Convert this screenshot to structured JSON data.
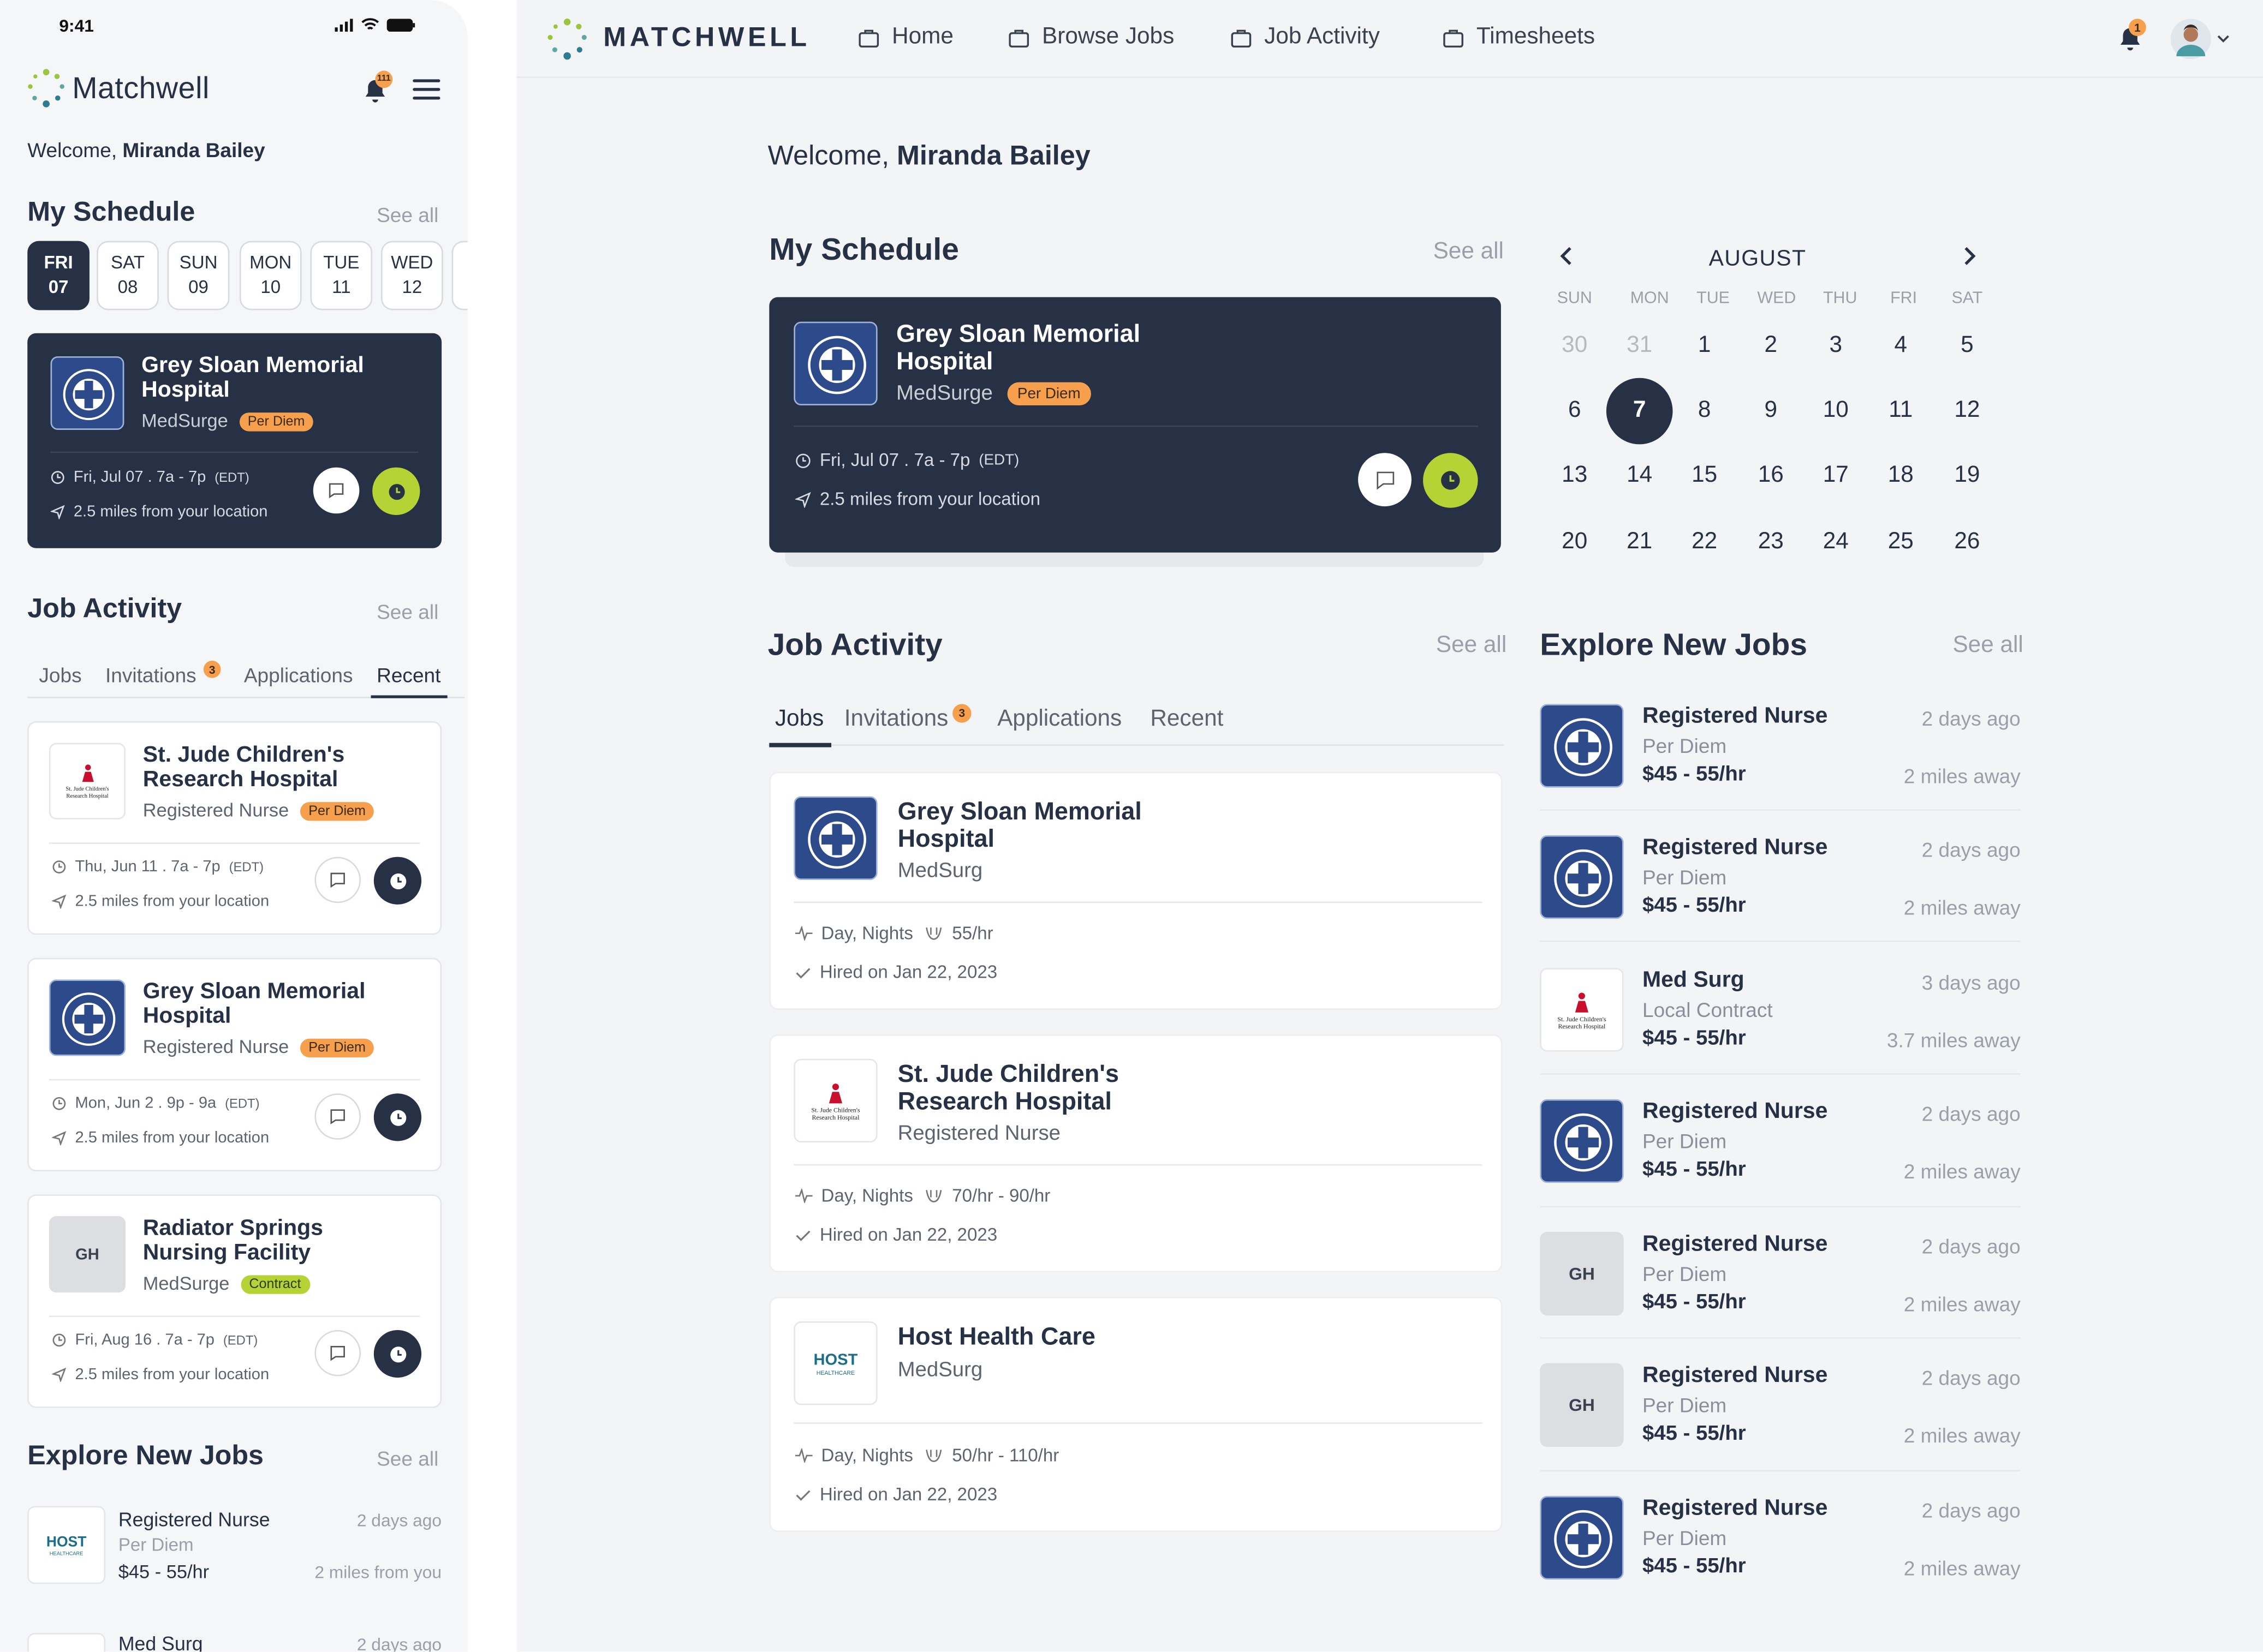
{
  "mobile": {
    "status": {
      "time": "9:41"
    },
    "brand": "Matchwell",
    "notifications_count": "111",
    "welcome_prefix": "Welcome, ",
    "user_name": "Miranda Bailey",
    "schedule": {
      "title": "My Schedule",
      "see_all": "See all",
      "days": [
        {
          "dow": "FRI",
          "num": "07"
        },
        {
          "dow": "SAT",
          "num": "08"
        },
        {
          "dow": "SUN",
          "num": "09"
        },
        {
          "dow": "MON",
          "num": "10"
        },
        {
          "dow": "TUE",
          "num": "11"
        },
        {
          "dow": "WED",
          "num": "12"
        },
        {
          "dow": "T",
          "num": ""
        }
      ],
      "card": {
        "hospital": "Grey Sloan Memorial Hospital",
        "dept": "MedSurge",
        "badge": "Per Diem",
        "date": "Fri, Jul 07 . 7a - 7p",
        "tz": "(EDT)",
        "distance": "2.5 miles from your location"
      }
    },
    "activity": {
      "title": "Job Activity",
      "see_all": "See all",
      "tabs": [
        "Jobs",
        "Invitations",
        "Applications",
        "Recent"
      ],
      "invitations_count": "3",
      "cards": [
        {
          "hospital": "St. Jude Children's Research Hospital",
          "role": "Registered Nurse",
          "badge": "Per Diem",
          "date": "Thu, Jun 11 . 7a - 7p",
          "tz": "(EDT)",
          "distance": "2.5 miles from your location"
        },
        {
          "hospital": "Grey Sloan Memorial Hospital",
          "role": "Registered Nurse",
          "badge": "Per Diem",
          "date": "Mon, Jun 2 . 9p - 9a",
          "tz": "(EDT)",
          "distance": "2.5 miles from your location"
        },
        {
          "hospital": "Radiator Springs Nursing Facility",
          "role": "MedSurge",
          "badge": "Contract",
          "initials": "GH",
          "date": "Fri, Aug 16 . 7a - 7p",
          "tz": "(EDT)",
          "distance": "2.5 miles from your location"
        }
      ]
    },
    "explore": {
      "title": "Explore New Jobs",
      "see_all": "See all",
      "items": [
        {
          "title": "Registered Nurse",
          "type": "Per Diem",
          "pay": "$45 - 55/hr",
          "ago": "2 days ago",
          "distance": "2 miles from you"
        },
        {
          "title": "Med Surg",
          "ago": "2 days ago"
        }
      ]
    }
  },
  "desktop": {
    "brand": "MATCHWELL",
    "nav": [
      "Home",
      "Browse Jobs",
      "Job Activity",
      "Timesheets"
    ],
    "notif_count": "1",
    "welcome_prefix": "Welcome, ",
    "user_name": "Miranda Bailey",
    "schedule": {
      "title": "My Schedule",
      "see_all": "See all",
      "card": {
        "hospital": "Grey Sloan Memorial Hospital",
        "dept": "MedSurge",
        "badge": "Per Diem",
        "date": "Fri, Jul 07 . 7a - 7p",
        "tz": "(EDT)",
        "distance": "2.5 miles from your location"
      }
    },
    "calendar": {
      "month": "AUGUST",
      "dows": [
        "SUN",
        "MON",
        "TUE",
        "WED",
        "THU",
        "FRI",
        "SAT"
      ],
      "weeks": [
        [
          "30",
          "31",
          "1",
          "2",
          "3",
          "4",
          "5"
        ],
        [
          "6",
          "7",
          "8",
          "9",
          "10",
          "11",
          "12"
        ],
        [
          "13",
          "14",
          "15",
          "16",
          "17",
          "18",
          "19"
        ],
        [
          "20",
          "21",
          "22",
          "23",
          "24",
          "25",
          "26"
        ]
      ],
      "selected": "7"
    },
    "activity": {
      "title": "Job Activity",
      "see_all": "See all",
      "tabs": [
        "Jobs",
        "Invitations",
        "Applications",
        "Recent"
      ],
      "invitations_count": "3",
      "cards": [
        {
          "hospital": "Grey Sloan Memorial Hospital",
          "dept": "MedSurg",
          "shift": "Day, Nights",
          "rate": "55/hr",
          "hired": "Hired on Jan 22, 2023"
        },
        {
          "hospital": "St. Jude Children's Research Hospital",
          "dept": "Registered Nurse",
          "shift": "Day, Nights",
          "rate": "70/hr - 90/hr",
          "hired": "Hired on Jan 22, 2023"
        },
        {
          "hospital": "Host Health Care",
          "dept": "MedSurg",
          "shift": "Day, Nights",
          "rate": "50/hr - 110/hr",
          "hired": "Hired on Jan 22, 2023"
        }
      ]
    },
    "explore": {
      "title": "Explore New Jobs",
      "see_all": "See all",
      "items": [
        {
          "title": "Registered Nurse",
          "type": "Per Diem",
          "pay": "$45 - 55/hr",
          "ago": "2 days ago",
          "distance": "2 miles away",
          "logo": "grey-sloan"
        },
        {
          "title": "Registered Nurse",
          "type": "Per Diem",
          "pay": "$45 - 55/hr",
          "ago": "2 days ago",
          "distance": "2 miles away",
          "logo": "grey-sloan"
        },
        {
          "title": "Med Surg",
          "type": "Local Contract",
          "pay": "$45 - 55/hr",
          "ago": "3 days ago",
          "distance": "3.7 miles away",
          "logo": "st-jude"
        },
        {
          "title": "Registered Nurse",
          "type": "Per Diem",
          "pay": "$45 - 55/hr",
          "ago": "2 days ago",
          "distance": "2 miles away",
          "logo": "grey-sloan"
        },
        {
          "title": "Registered Nurse",
          "type": "Per Diem",
          "pay": "$45 - 55/hr",
          "ago": "2 days ago",
          "distance": "2 miles away",
          "logo": "gh",
          "initials": "GH"
        },
        {
          "title": "Registered Nurse",
          "type": "Per Diem",
          "pay": "$45 - 55/hr",
          "ago": "2 days ago",
          "distance": "2 miles away",
          "logo": "gh",
          "initials": "GH"
        },
        {
          "title": "Registered Nurse",
          "type": "Per Diem",
          "pay": "$45 - 55/hr",
          "ago": "2 days ago",
          "distance": "2 miles away",
          "logo": "grey-sloan"
        }
      ]
    }
  },
  "logos": {
    "st_jude_text": "St. Jude Children's Research Hospital",
    "host_text": "HOST",
    "host_sub": "HEALTHCARE"
  },
  "colors": {
    "navy": "#273145",
    "accent_green": "#b5d335",
    "badge_orange": "#f6a04d",
    "logo_blue": "#2d4a8a"
  }
}
